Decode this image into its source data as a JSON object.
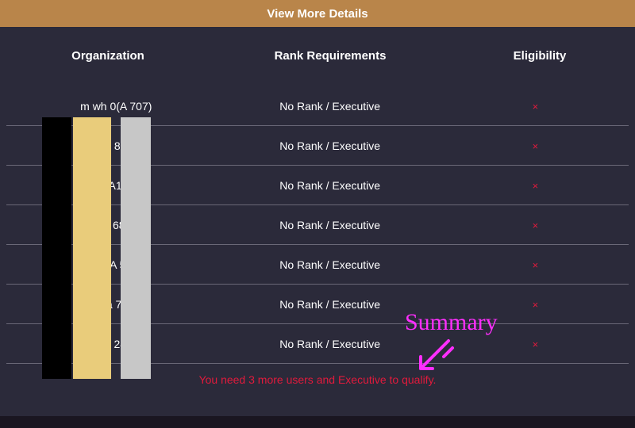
{
  "banner": {
    "title": "View More Details"
  },
  "headers": {
    "organization": "Organization",
    "rank": "Rank Requirements",
    "eligibility": "Eligibility"
  },
  "rows": [
    {
      "org": "m   wh    0(A    707)",
      "rank": "No Rank / Executive",
      "elig": "×"
    },
    {
      "org": "en    81       )",
      "rank": "No Rank / Executive",
      "elig": "×"
    },
    {
      "org": "lu    A1       2)",
      "rank": "No Rank / Executive",
      "elig": "×"
    },
    {
      "org": "to    68       )",
      "rank": "No Rank / Executive",
      "elig": "×"
    },
    {
      "org": "   19    (A    524)",
      "rank": "No Rank / Executive",
      "elig": "×"
    },
    {
      "org": "ola   72       )",
      "rank": "No Rank / Executive",
      "elig": "×"
    },
    {
      "org": "sa    24       )",
      "rank": "No Rank / Executive",
      "elig": "×"
    }
  ],
  "summary_text": "You need 3 more users and Executive to qualify.",
  "annotation": {
    "label": "Summary"
  }
}
